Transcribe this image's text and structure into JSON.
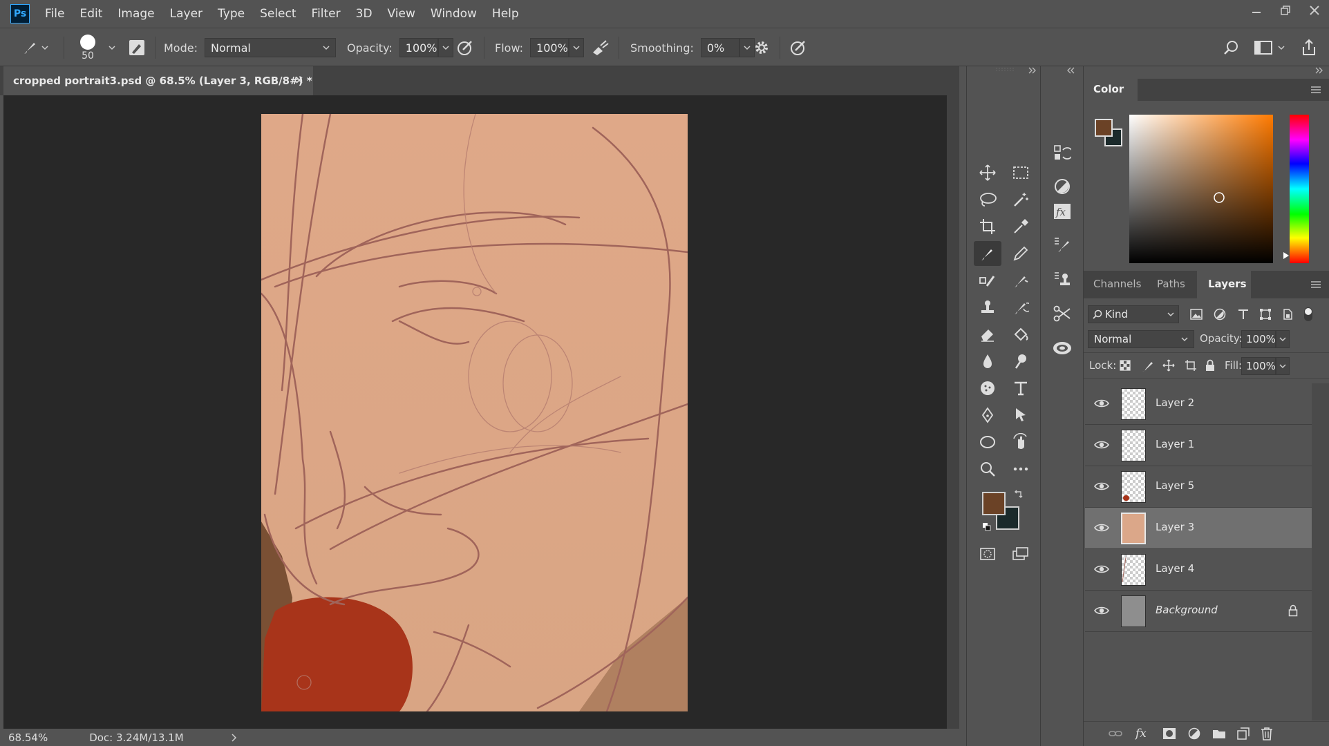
{
  "app": {
    "logo": "Ps"
  },
  "menu": [
    "File",
    "Edit",
    "Image",
    "Layer",
    "Type",
    "Select",
    "Filter",
    "3D",
    "View",
    "Window",
    "Help"
  ],
  "options_bar": {
    "brush_size": "50",
    "mode_label": "Mode:",
    "mode_value": "Normal",
    "opacity_label": "Opacity:",
    "opacity_value": "100%",
    "flow_label": "Flow:",
    "flow_value": "100%",
    "smoothing_label": "Smoothing:",
    "smoothing_value": "0%"
  },
  "document_tab": {
    "title": "cropped portrait3.psd @ 68.5% (Layer 3, RGB/8#) *"
  },
  "status_bar": {
    "zoom": "68.54%",
    "doc_size": "Doc: 3.24M/13.1M"
  },
  "colors": {
    "foreground": "#6b4226",
    "background": "#1b2a2b",
    "skin": "#dba789",
    "sketch": "#a4645a",
    "red": "#a8341a",
    "accent": "#31a8ff"
  },
  "color_panel": {
    "title": "Color"
  },
  "layers_panel": {
    "tabs": [
      "Channels",
      "Paths",
      "Layers"
    ],
    "active_tab": "Layers",
    "filter_kind": "Kind",
    "blend_mode": "Normal",
    "opacity_label": "Opacity:",
    "opacity_value": "100%",
    "lock_label": "Lock:",
    "fill_label": "Fill:",
    "fill_value": "100%",
    "layers": [
      {
        "name": "Layer 2",
        "visible": true,
        "selected": false
      },
      {
        "name": "Layer 1",
        "visible": true,
        "selected": false
      },
      {
        "name": "Layer 5",
        "visible": true,
        "selected": false
      },
      {
        "name": "Layer 3",
        "visible": true,
        "selected": true
      },
      {
        "name": "Layer 4",
        "visible": true,
        "selected": false
      },
      {
        "name": "Background",
        "visible": true,
        "selected": false,
        "locked": true
      }
    ]
  },
  "icons": [
    "brush-icon",
    "settings-gear-icon",
    "search-icon",
    "workspace-icon",
    "share-icon",
    "move-icon",
    "marquee-icon",
    "lasso-icon",
    "magic-wand-icon",
    "crop-icon",
    "eyedropper-icon",
    "brush-tool-icon",
    "pencil-icon",
    "healing-icon",
    "mixer-brush-icon",
    "stamp-icon",
    "history-brush-icon",
    "eraser-icon",
    "paint-bucket-icon",
    "blur-icon",
    "dodge-icon",
    "sponge-icon",
    "type-icon",
    "pen-icon",
    "path-select-icon",
    "ellipse-icon",
    "hand-rotate-icon",
    "zoom-icon",
    "more-icon",
    "eye-icon",
    "lock-icon",
    "link-icon",
    "fx-icon",
    "mask-icon",
    "adjustment-icon",
    "folder-icon",
    "new-layer-icon",
    "trash-icon"
  ]
}
